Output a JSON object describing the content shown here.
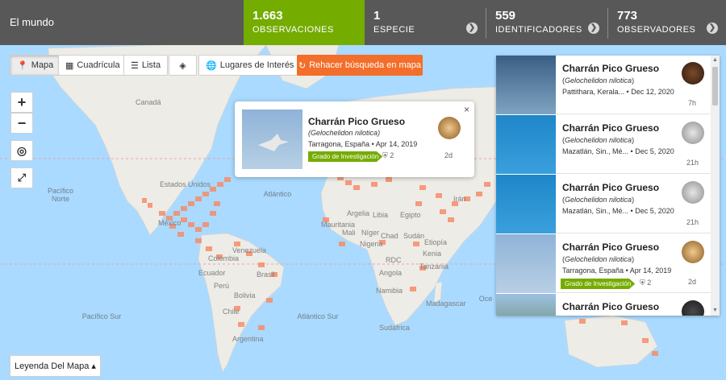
{
  "topbar": {
    "place": "El mundo",
    "stats": [
      {
        "num": "1.663",
        "label": "OBSERVACIONES",
        "active": true
      },
      {
        "num": "1",
        "label": "ESPECIE"
      },
      {
        "num": "559",
        "label": "IDENTIFICADORES"
      },
      {
        "num": "773",
        "label": "OBSERVADORES"
      }
    ],
    "arrow_icon": "chevron-right-icon"
  },
  "toolbar": {
    "map": "Mapa",
    "grid": "Cuadrícula",
    "list": "Lista",
    "places": "Lugares de Interés",
    "redo": "Rehacer búsqueda en mapa"
  },
  "zoom": {
    "in": "+",
    "out": "−"
  },
  "map_labels": {
    "pacific_north": "Pacífico Norte",
    "atlantic": "Atlántico",
    "pacific_south": "Pacífico Sur",
    "atlantic_south": "Atlántico Sur",
    "ocean_right": "Oce",
    "countries": {
      "canada": "Canadá",
      "usa": "Estados Unidos",
      "mexico": "México",
      "venezuela": "Venezuela",
      "colombia": "Colombia",
      "peru": "Perú",
      "brazil": "Brasil",
      "bolivia": "Bolivia",
      "chile": "Chile",
      "argentina": "Argentina",
      "algeria": "Argelia",
      "libya": "Libia",
      "egypt": "Egipto",
      "mali": "Mali",
      "niger": "Níger",
      "chad": "Chad",
      "sudan": "Sudán",
      "nigeria": "Nigeria",
      "ethiopia": "Etiopía",
      "kenya": "Kenia",
      "drc": "RDC",
      "angola": "Angola",
      "namibia": "Namibia",
      "sudafrica": "Sudáfrica",
      "madagascar": "Madagascar",
      "mauritania": "Mauritania",
      "iran": "Irán",
      "tanzania": "Tanzania",
      "ecuador": "Ecuador"
    }
  },
  "popup": {
    "name": "Charrán Pico Grueso",
    "sci": "Gelochelidon nilotica",
    "place": "Tarragona, España",
    "date": "Apr 14, 2019",
    "badge": "Grado de Investigación",
    "ids": "2",
    "ago": "2d",
    "close": "×"
  },
  "list": [
    {
      "name": "Charrán Pico Grueso",
      "sci": "Gelochelidon nilotica",
      "place": "Pattithara, Kerala...",
      "date": "Dec 12, 2020",
      "ago": "7h"
    },
    {
      "name": "Charrán Pico Grueso",
      "sci": "Gelochelidon nilotica",
      "place": "Mazatlán, Sin., Mé...",
      "date": "Dec 5, 2020",
      "ago": "21h"
    },
    {
      "name": "Charrán Pico Grueso",
      "sci": "Gelochelidon nilotica",
      "place": "Mazatlán, Sin., Mé...",
      "date": "Dec 5, 2020",
      "ago": "21h"
    },
    {
      "name": "Charrán Pico Grueso",
      "sci": "Gelochelidon nilotica",
      "place": "Tarragona, España",
      "date": "Apr 14, 2019",
      "badge": "Grado de Investigación",
      "ids": "2",
      "ago": "2d"
    },
    {
      "name": "Charrán Pico Grueso"
    }
  ],
  "legend": "Leyenda Del Mapa ▴",
  "colors": {
    "accent": "#74ac00",
    "redo": "#f36e2a",
    "topbar": "#585858",
    "grid": "#f78c6b"
  }
}
